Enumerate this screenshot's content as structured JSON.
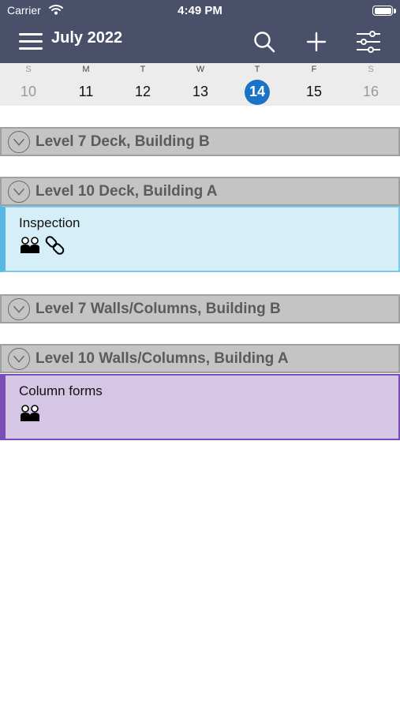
{
  "status_bar": {
    "carrier": "Carrier",
    "time": "4:49 PM"
  },
  "header": {
    "month_title": "July 2022"
  },
  "week": {
    "days": [
      {
        "dow": "S",
        "num": "10"
      },
      {
        "dow": "M",
        "num": "11"
      },
      {
        "dow": "T",
        "num": "12"
      },
      {
        "dow": "W",
        "num": "13"
      },
      {
        "dow": "T",
        "num": "14"
      },
      {
        "dow": "F",
        "num": "15"
      },
      {
        "dow": "S",
        "num": "16"
      }
    ],
    "selected": "14"
  },
  "groups": [
    {
      "title": "Level 7 Deck, Building B"
    },
    {
      "title": "Level 10 Deck, Building A",
      "tasks": [
        {
          "label": "Inspection",
          "icons": [
            "people-icon",
            "link-icon"
          ]
        }
      ]
    },
    {
      "title": "Level 7 Walls/Columns, Building B"
    },
    {
      "title": "Level 10 Walls/Columns, Building A",
      "tasks": [
        {
          "label": "Column forms",
          "icons": [
            "people-icon"
          ]
        }
      ]
    }
  ],
  "colors": {
    "header_bg": "#4a5069",
    "today_circle": "#1a73c8",
    "inspection_bg": "#d6eef8",
    "inspection_border": "#56b8e3",
    "column_bg": "#d4c6e4",
    "column_border": "#7a4eb6",
    "group_bg": "#c4c4c4"
  }
}
